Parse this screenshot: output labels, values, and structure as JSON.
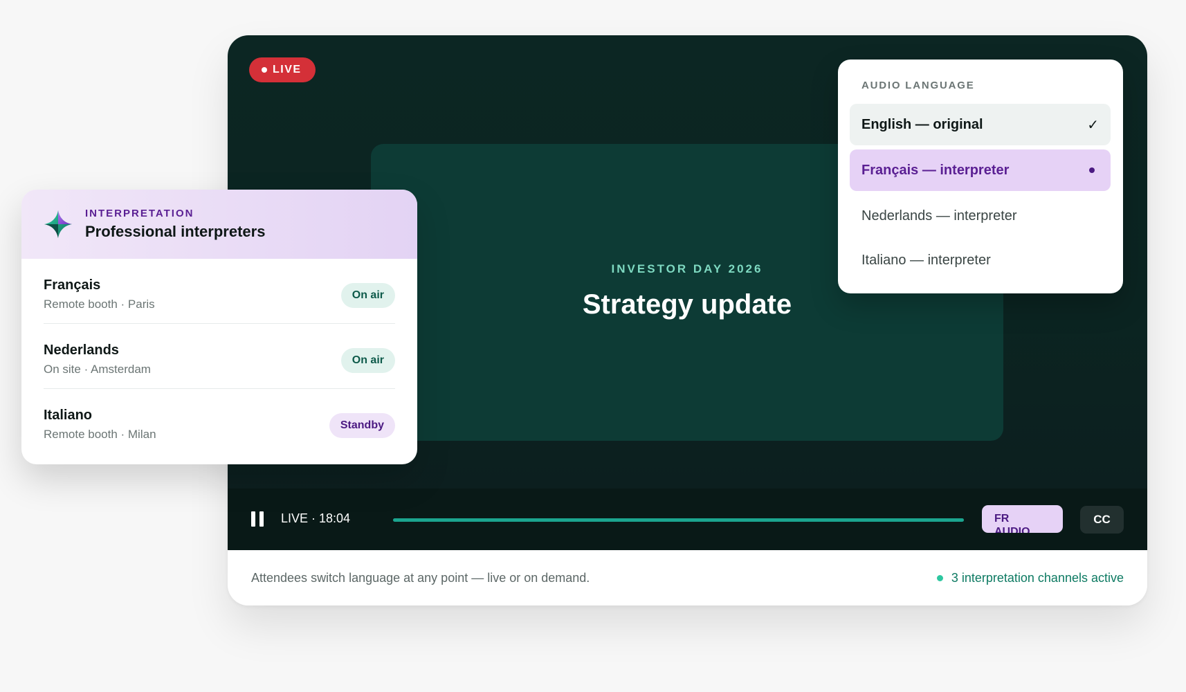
{
  "player": {
    "live_badge": "LIVE",
    "stage_eyebrow": "INVESTOR DAY 2026",
    "stage_title": "Strategy update",
    "controls": {
      "live_time": "LIVE · 18:04",
      "progress": 1.0,
      "fr_button_lines": [
        "FR",
        "AUDIO"
      ],
      "cc_label": "CC"
    },
    "footer": {
      "note": "Attendees switch language at any point — live or on demand.",
      "status": "3 interpretation channels active"
    }
  },
  "audio_menu": {
    "heading": "AUDIO LANGUAGE",
    "options": [
      {
        "label": "English — original",
        "state": "selected",
        "marker": "✓"
      },
      {
        "label": "Français — interpreter",
        "state": "active",
        "marker": "bullet"
      },
      {
        "label": "Nederlands — interpreter",
        "state": "normal"
      },
      {
        "label": "Italiano — interpreter",
        "state": "normal"
      }
    ]
  },
  "interpretation": {
    "eyebrow": "INTERPRETATION",
    "title": "Professional interpreters",
    "rows": [
      {
        "name": "Français",
        "detail": "Remote booth · Paris",
        "badge": "On air"
      },
      {
        "name": "Nederlands",
        "detail": "On site · Amsterdam",
        "badge": "On air"
      },
      {
        "name": "Italiano",
        "detail": "Remote booth · Milan",
        "badge": "Standby"
      }
    ]
  },
  "colors": {
    "live_red": "#d43038",
    "accent_teal": "#1ba58f",
    "accent_purple": "#4b1a82",
    "lavender": "#e6d2f6",
    "dark_video": "#0c2623"
  }
}
